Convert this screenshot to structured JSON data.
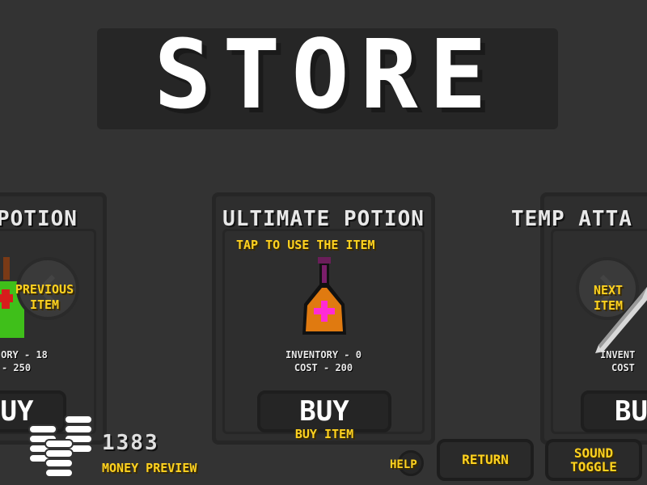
{
  "screen": {
    "title": "STORE"
  },
  "items": {
    "previous": {
      "name": "POTION",
      "inventory": "ORY - 18",
      "cost": "- 250",
      "buy_label": "UY"
    },
    "current": {
      "name": "ULTIMATE POTION",
      "hint": "TAP TO USE THE ITEM",
      "inventory": "INVENTORY - 0",
      "cost": "COST - 200",
      "buy_label": "BUY",
      "buy_caption": "BUY ITEM"
    },
    "next": {
      "name": "TEMP ATTA",
      "inventory": "INVENT",
      "cost": "COST",
      "buy_label": "BU"
    }
  },
  "navigation": {
    "previous_label": "PREVIOUS ITEM",
    "next_label": "NEXT ITEM"
  },
  "footer": {
    "money_value": "1383",
    "money_label": "MONEY PREVIEW",
    "help_label": "HELP",
    "return_label": "RETURN",
    "sound_label": "SOUND TOGGLE"
  },
  "colors": {
    "background": "#333333",
    "accent": "#ffd21f",
    "potion_orange": "#e07a10",
    "potion_cross": "#ff2bd6",
    "potion_green": "#3fbf1a"
  },
  "icons": [
    "coin-stack-icon",
    "potion-icon",
    "sword-icon",
    "chevron-left-icon",
    "chevron-right-icon"
  ]
}
